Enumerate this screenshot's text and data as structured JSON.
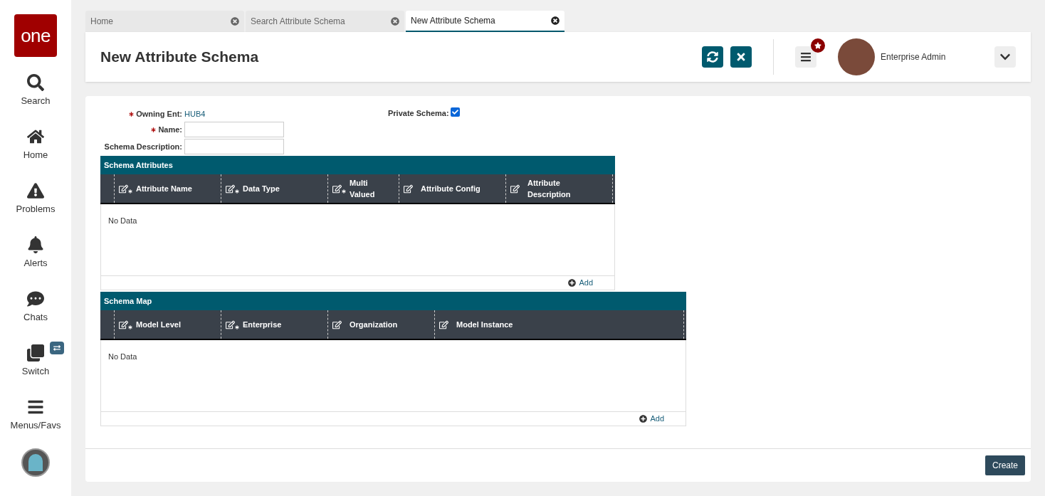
{
  "sidebar": {
    "logo": "one",
    "items": [
      {
        "kind": "search",
        "label": "Search"
      },
      {
        "kind": "home",
        "label": "Home"
      },
      {
        "kind": "problems",
        "label": "Problems"
      },
      {
        "kind": "alerts",
        "label": "Alerts"
      },
      {
        "kind": "chats",
        "label": "Chats"
      },
      {
        "kind": "switch",
        "label": "Switch"
      },
      {
        "kind": "menus",
        "label": "Menus/Favs"
      }
    ]
  },
  "tabs": [
    {
      "label": "Home",
      "selected": false
    },
    {
      "label": "Search Attribute Schema",
      "selected": false
    },
    {
      "label": "New Attribute Schema",
      "selected": true
    }
  ],
  "header": {
    "title": "New Attribute Schema",
    "user_role": "Enterprise Admin"
  },
  "form": {
    "owning_ent": {
      "label": "Owning Ent:",
      "value": "HUB4",
      "required": true
    },
    "name": {
      "label": "Name:",
      "required": true
    },
    "description": {
      "label": "Schema Description:",
      "required": false
    },
    "private_schema": {
      "label": "Private Schema:",
      "checked": true
    }
  },
  "tables": [
    {
      "title": "Schema Attributes",
      "columns": [
        {
          "label": "Attribute Name",
          "required": true
        },
        {
          "label": "Data Type",
          "required": true
        },
        {
          "label": "Multi Valued",
          "required": true
        },
        {
          "label": "Attribute Config",
          "required": false
        },
        {
          "label": "Attribute Description",
          "required": false
        }
      ],
      "empty_text": "No Data",
      "add_label": "Add"
    },
    {
      "title": "Schema Map",
      "columns": [
        {
          "label": "Model Level",
          "required": true
        },
        {
          "label": "Enterprise",
          "required": true
        },
        {
          "label": "Organization",
          "required": false
        },
        {
          "label": "Model Instance",
          "required": false
        }
      ],
      "empty_text": "No Data",
      "add_label": "Add"
    }
  ],
  "create_button": "Create"
}
